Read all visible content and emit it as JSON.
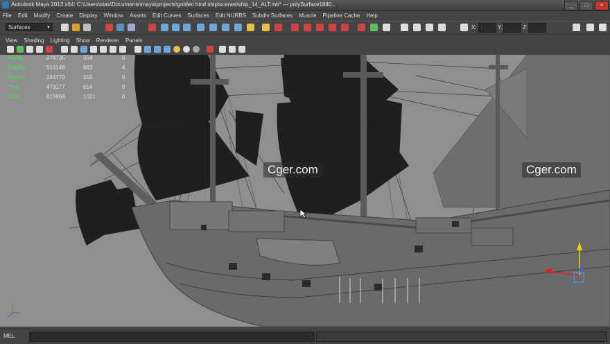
{
  "window": {
    "title": "Autodesk Maya 2013 x64: C:\\Users\\stas\\Documents\\maya\\projects\\golden hind ship\\scenes\\ship_14_ALT.mb*   ---   polySurface1840...",
    "controls": [
      "_",
      "□",
      "×"
    ]
  },
  "menubar": {
    "items": [
      "File",
      "Edit",
      "Modify",
      "Create",
      "Display",
      "Window",
      "Assets",
      "Edit Curves",
      "Surfaces",
      "Edit NURBS",
      "Subdiv Surfaces",
      "Muscle",
      "Pipeline Cache",
      "Help"
    ]
  },
  "statusline": {
    "menu_set": "Surfaces",
    "x_label": "X:",
    "y_label": "Y:",
    "z_label": "Z:"
  },
  "panel_menu": {
    "items": [
      "View",
      "Shading",
      "Lighting",
      "Show",
      "Renderer",
      "Panels"
    ]
  },
  "hud": {
    "rows": [
      {
        "label": "Verts:",
        "v1": "274735",
        "v2": "354",
        "v3": "0"
      },
      {
        "label": "Edges:",
        "v1": "514148",
        "v2": "663",
        "v3": "4"
      },
      {
        "label": "Faces:",
        "v1": "244770",
        "v2": "315",
        "v3": "0"
      },
      {
        "label": "Tris:",
        "v1": "473177",
        "v2": "614",
        "v3": "0"
      },
      {
        "label": "UVs:",
        "v1": "819904",
        "v2": "1031",
        "v3": "0"
      }
    ]
  },
  "watermarks": [
    "Cger.com",
    "Cger.com"
  ],
  "command_line": {
    "label": "MEL"
  },
  "colors": {
    "accent": "#2b7bbd",
    "hud_label": "#5bd45b",
    "sail": "#1f1f1f",
    "hull": "#6a6a6a"
  }
}
